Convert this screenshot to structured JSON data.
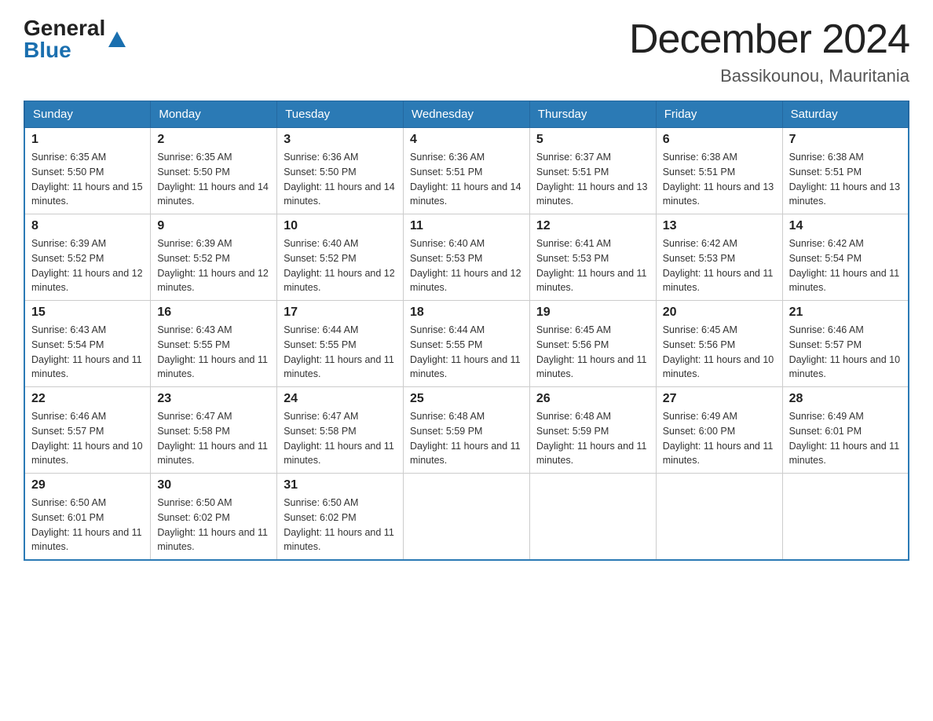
{
  "logo": {
    "general": "General",
    "blue": "Blue"
  },
  "title": "December 2024",
  "subtitle": "Bassikounou, Mauritania",
  "weekdays": [
    "Sunday",
    "Monday",
    "Tuesday",
    "Wednesday",
    "Thursday",
    "Friday",
    "Saturday"
  ],
  "weeks": [
    [
      {
        "day": "1",
        "sunrise": "6:35 AM",
        "sunset": "5:50 PM",
        "daylight": "11 hours and 15 minutes."
      },
      {
        "day": "2",
        "sunrise": "6:35 AM",
        "sunset": "5:50 PM",
        "daylight": "11 hours and 14 minutes."
      },
      {
        "day": "3",
        "sunrise": "6:36 AM",
        "sunset": "5:50 PM",
        "daylight": "11 hours and 14 minutes."
      },
      {
        "day": "4",
        "sunrise": "6:36 AM",
        "sunset": "5:51 PM",
        "daylight": "11 hours and 14 minutes."
      },
      {
        "day": "5",
        "sunrise": "6:37 AM",
        "sunset": "5:51 PM",
        "daylight": "11 hours and 13 minutes."
      },
      {
        "day": "6",
        "sunrise": "6:38 AM",
        "sunset": "5:51 PM",
        "daylight": "11 hours and 13 minutes."
      },
      {
        "day": "7",
        "sunrise": "6:38 AM",
        "sunset": "5:51 PM",
        "daylight": "11 hours and 13 minutes."
      }
    ],
    [
      {
        "day": "8",
        "sunrise": "6:39 AM",
        "sunset": "5:52 PM",
        "daylight": "11 hours and 12 minutes."
      },
      {
        "day": "9",
        "sunrise": "6:39 AM",
        "sunset": "5:52 PM",
        "daylight": "11 hours and 12 minutes."
      },
      {
        "day": "10",
        "sunrise": "6:40 AM",
        "sunset": "5:52 PM",
        "daylight": "11 hours and 12 minutes."
      },
      {
        "day": "11",
        "sunrise": "6:40 AM",
        "sunset": "5:53 PM",
        "daylight": "11 hours and 12 minutes."
      },
      {
        "day": "12",
        "sunrise": "6:41 AM",
        "sunset": "5:53 PM",
        "daylight": "11 hours and 11 minutes."
      },
      {
        "day": "13",
        "sunrise": "6:42 AM",
        "sunset": "5:53 PM",
        "daylight": "11 hours and 11 minutes."
      },
      {
        "day": "14",
        "sunrise": "6:42 AM",
        "sunset": "5:54 PM",
        "daylight": "11 hours and 11 minutes."
      }
    ],
    [
      {
        "day": "15",
        "sunrise": "6:43 AM",
        "sunset": "5:54 PM",
        "daylight": "11 hours and 11 minutes."
      },
      {
        "day": "16",
        "sunrise": "6:43 AM",
        "sunset": "5:55 PM",
        "daylight": "11 hours and 11 minutes."
      },
      {
        "day": "17",
        "sunrise": "6:44 AM",
        "sunset": "5:55 PM",
        "daylight": "11 hours and 11 minutes."
      },
      {
        "day": "18",
        "sunrise": "6:44 AM",
        "sunset": "5:55 PM",
        "daylight": "11 hours and 11 minutes."
      },
      {
        "day": "19",
        "sunrise": "6:45 AM",
        "sunset": "5:56 PM",
        "daylight": "11 hours and 11 minutes."
      },
      {
        "day": "20",
        "sunrise": "6:45 AM",
        "sunset": "5:56 PM",
        "daylight": "11 hours and 10 minutes."
      },
      {
        "day": "21",
        "sunrise": "6:46 AM",
        "sunset": "5:57 PM",
        "daylight": "11 hours and 10 minutes."
      }
    ],
    [
      {
        "day": "22",
        "sunrise": "6:46 AM",
        "sunset": "5:57 PM",
        "daylight": "11 hours and 10 minutes."
      },
      {
        "day": "23",
        "sunrise": "6:47 AM",
        "sunset": "5:58 PM",
        "daylight": "11 hours and 11 minutes."
      },
      {
        "day": "24",
        "sunrise": "6:47 AM",
        "sunset": "5:58 PM",
        "daylight": "11 hours and 11 minutes."
      },
      {
        "day": "25",
        "sunrise": "6:48 AM",
        "sunset": "5:59 PM",
        "daylight": "11 hours and 11 minutes."
      },
      {
        "day": "26",
        "sunrise": "6:48 AM",
        "sunset": "5:59 PM",
        "daylight": "11 hours and 11 minutes."
      },
      {
        "day": "27",
        "sunrise": "6:49 AM",
        "sunset": "6:00 PM",
        "daylight": "11 hours and 11 minutes."
      },
      {
        "day": "28",
        "sunrise": "6:49 AM",
        "sunset": "6:01 PM",
        "daylight": "11 hours and 11 minutes."
      }
    ],
    [
      {
        "day": "29",
        "sunrise": "6:50 AM",
        "sunset": "6:01 PM",
        "daylight": "11 hours and 11 minutes."
      },
      {
        "day": "30",
        "sunrise": "6:50 AM",
        "sunset": "6:02 PM",
        "daylight": "11 hours and 11 minutes."
      },
      {
        "day": "31",
        "sunrise": "6:50 AM",
        "sunset": "6:02 PM",
        "daylight": "11 hours and 11 minutes."
      },
      null,
      null,
      null,
      null
    ]
  ],
  "labels": {
    "sunrise": "Sunrise:",
    "sunset": "Sunset:",
    "daylight": "Daylight:"
  }
}
